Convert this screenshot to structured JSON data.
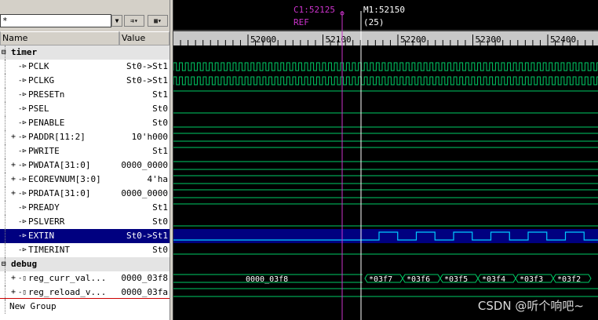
{
  "toolbar": {
    "combo_text": "*"
  },
  "header": {
    "name": "Name",
    "value": "Value"
  },
  "cursors": {
    "c1": "C1:52125",
    "m1": "M1:52150",
    "ref": "REF",
    "delta": "(25)"
  },
  "ruler_labels": [
    "52000",
    "52100",
    "52200",
    "52300",
    "52400"
  ],
  "groups": {
    "timer": "timer",
    "debug": "debug",
    "new_group": "New Group"
  },
  "signals": [
    {
      "name": "PCLK",
      "value": "St0->St1"
    },
    {
      "name": "PCLKG",
      "value": "St0->St1"
    },
    {
      "name": "PRESETn",
      "value": "St1"
    },
    {
      "name": "PSEL",
      "value": "St0"
    },
    {
      "name": "PENABLE",
      "value": "St0"
    },
    {
      "name": "PADDR[11:2]",
      "value": "10'h000"
    },
    {
      "name": "PWRITE",
      "value": "St1"
    },
    {
      "name": "PWDATA[31:0]",
      "value": "0000_0000"
    },
    {
      "name": "ECOREVNUM[3:0]",
      "value": "4'ha"
    },
    {
      "name": "PRDATA[31:0]",
      "value": "0000_0000"
    },
    {
      "name": "PREADY",
      "value": "St1"
    },
    {
      "name": "PSLVERR",
      "value": "St0"
    },
    {
      "name": "EXTIN",
      "value": "St0->St1"
    },
    {
      "name": "TIMERINT",
      "value": "St0"
    }
  ],
  "debug_signals": [
    {
      "name": "reg_curr_val...",
      "value": "0000_03f8"
    },
    {
      "name": "reg_reload_v...",
      "value": "0000_03fa"
    }
  ],
  "bus_curr": [
    "0000_03f8",
    "*03f7",
    "*03f6",
    "*03f5",
    "*03f4",
    "*03f3",
    "*03f2"
  ],
  "watermark": "CSDN @听个响吧~",
  "colors": {
    "wave": "#00cc66",
    "selected": "#000080",
    "cursor_c1": "#cc33cc",
    "cursor_m1": "#ffffff",
    "bus_text": "#ffffff"
  }
}
